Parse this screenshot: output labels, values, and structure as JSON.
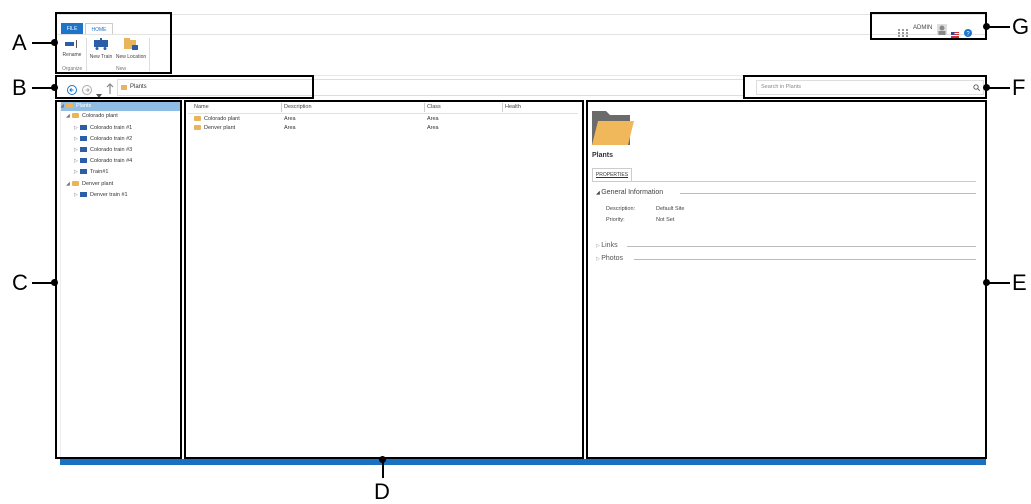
{
  "ribbon": {
    "tabs": {
      "file": "FILE",
      "home": "HOME"
    },
    "buttons": {
      "rename": "Rename",
      "new_train": "New Train",
      "new_location": "New Location"
    },
    "groups": {
      "organize": "Organize",
      "new": "New"
    }
  },
  "user": {
    "name": "ADMIN"
  },
  "navigation": {
    "address": "Plants"
  },
  "search": {
    "placeholder": "Search in Plants"
  },
  "tree": {
    "root": "Plants",
    "items": [
      {
        "label": "Colorado plant",
        "type": "folder",
        "expanded": true
      },
      {
        "label": "Colorado train #1",
        "type": "train"
      },
      {
        "label": "Colorado train #2",
        "type": "train"
      },
      {
        "label": "Colorado train #3",
        "type": "train"
      },
      {
        "label": "Colorado train #4",
        "type": "train"
      },
      {
        "label": "Train#1",
        "type": "train"
      },
      {
        "label": "Denver plant",
        "type": "folder",
        "expanded": true
      },
      {
        "label": "Denver train #1",
        "type": "train"
      }
    ]
  },
  "list": {
    "columns": [
      "Name",
      "Description",
      "Class",
      "Health"
    ],
    "rows": [
      {
        "name": "Colorado plant",
        "description": "Area",
        "class": "Area",
        "health": ""
      },
      {
        "name": "Denver plant",
        "description": "Area",
        "class": "Area",
        "health": ""
      }
    ]
  },
  "details": {
    "title": "Plants",
    "tab": "PROPERTIES",
    "section_general": "General Information",
    "fields": [
      {
        "label": "Description:",
        "value": "Default Site"
      },
      {
        "label": "Priority:",
        "value": "Not Set"
      }
    ],
    "section_links": "Links",
    "section_photos": "Photos"
  },
  "callouts": [
    "A",
    "B",
    "C",
    "D",
    "E",
    "F",
    "G"
  ],
  "colors": {
    "accent": "#1e74c8",
    "selection": "#8fbde6",
    "folder": "#e9b55c",
    "bottom_bar": "#1a71c2"
  }
}
